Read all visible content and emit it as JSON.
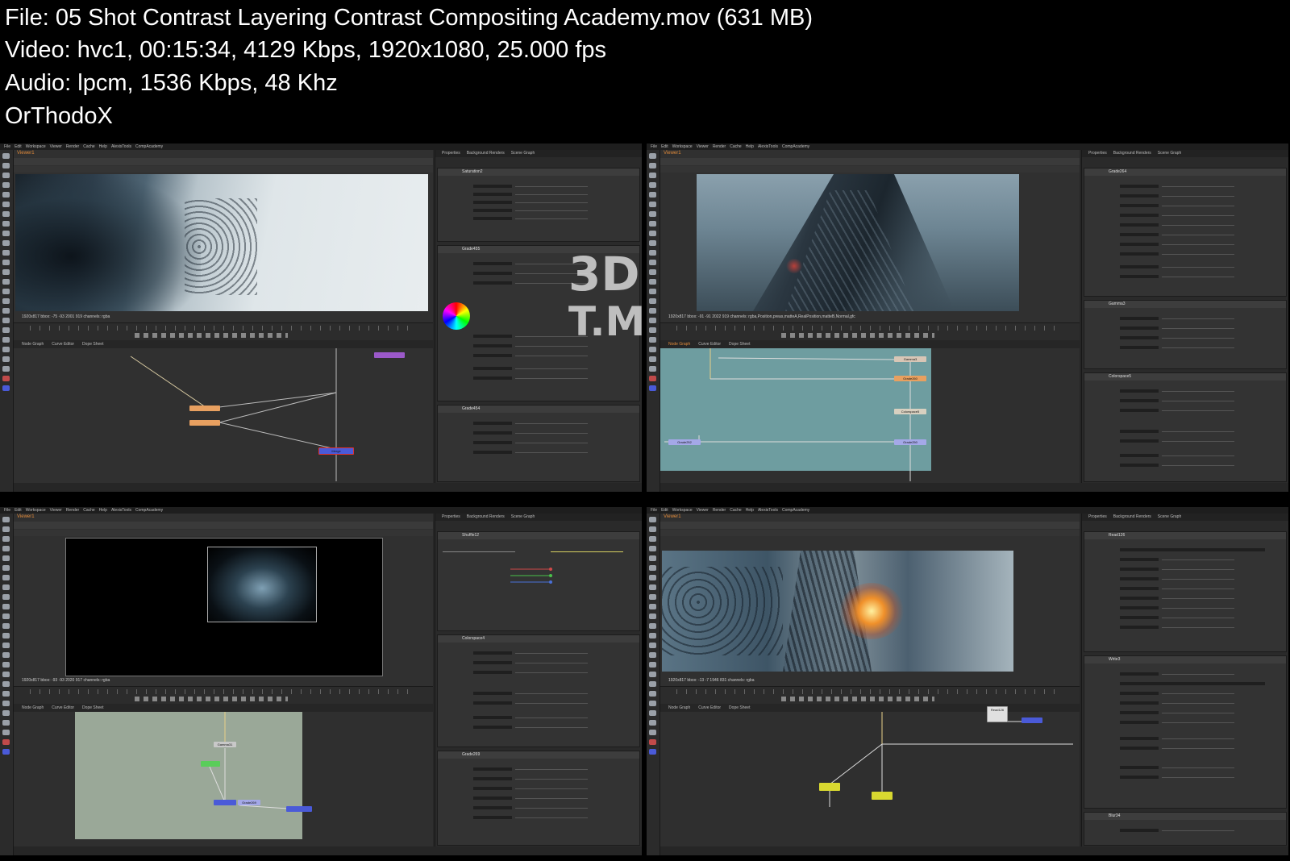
{
  "header": {
    "file_line": "File: 05 Shot Contrast  Layering Contrast  Compositing Academy.mov (631 MB)",
    "video_line": "Video: hvc1, 00:15:34, 4129 Kbps, 1920x1080, 25.000 fps",
    "audio_line": "Audio: lpcm, 1536 Kbps, 48 Khz",
    "author_line": "OrThodoX"
  },
  "watermark": {
    "line1": "3D",
    "line2": "T.M"
  },
  "app": {
    "menu": [
      "File",
      "Edit",
      "Workspace",
      "Viewer",
      "Render",
      "Cache",
      "Help",
      "AlexisTools",
      "CompAcademy"
    ],
    "viewer_tab": "Viewer1",
    "properties_tabs": [
      "Properties",
      "Background Renders",
      "Scene Graph"
    ],
    "nodegraph_tabs": [
      "Node Graph",
      "Curve Editor",
      "Dope Sheet"
    ]
  },
  "thumbs": [
    {
      "status": "1920x817  bbox: -75 -93 2001 919  channels: rgba",
      "panels": [
        "Saturation2",
        "Grade455",
        "Grade454"
      ],
      "nodes": [
        "Merge"
      ]
    },
    {
      "status": "1920x817  bbox: -91 -91 2022 919  channels: rgba,Position,preas,matteA,RealPosition,matteB,Normal,gfc",
      "panels": [
        "Grade264",
        "Gamma3",
        "Colorspace5"
      ],
      "nodes": [
        "Gamma3",
        "Grade260",
        "Colorspace5",
        "Grade252",
        "Grade250"
      ]
    },
    {
      "status": "1920x817  bbox: -93 -93 2020 917  channels: rgba",
      "panels": [
        "Shuffle12",
        "Colorspace4",
        "Grade269"
      ],
      "nodes": [
        "Gamma31",
        "Grade269"
      ]
    },
    {
      "status": "1920x817  bbox: -13 -7 1946 831  channels: rgba",
      "panels": [
        "Read126",
        "Write3",
        "Blur34"
      ],
      "nodes": [
        "Read126"
      ]
    }
  ],
  "colors": {
    "accent_orange": "#e08a3a",
    "node_orange": "#e8a060",
    "node_blue": "#4a5ad8",
    "node_purple": "#9b59c9",
    "node_yellow": "#d8d830",
    "node_graph_teal": "#6e9da0",
    "node_graph_sage": "#9aa898"
  }
}
